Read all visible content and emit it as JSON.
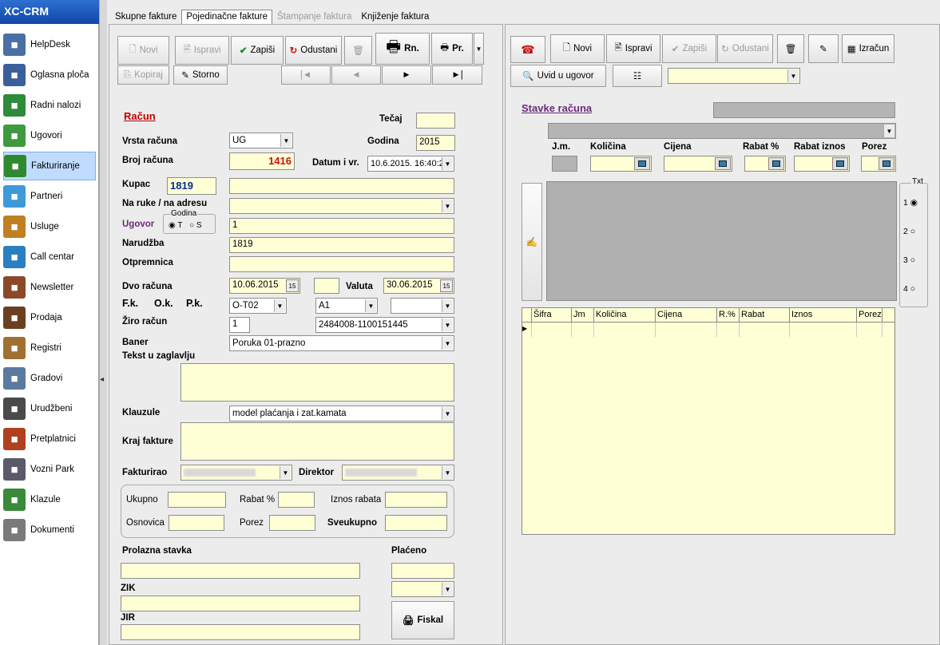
{
  "app": {
    "title": "XC-CRM"
  },
  "sidebar": {
    "items": [
      {
        "label": "HelpDesk",
        "icon": "helpdesk-icon",
        "color": "#4a6fa5"
      },
      {
        "label": "Oglasna ploča",
        "icon": "bulletin-board-icon",
        "color": "#3a5f9a"
      },
      {
        "label": "Radni nalozi",
        "icon": "work-orders-icon",
        "color": "#2e8b3a"
      },
      {
        "label": "Ugovori",
        "icon": "contracts-icon",
        "color": "#3f9a3f"
      },
      {
        "label": "Fakturiranje",
        "icon": "invoicing-icon",
        "color": "#2f8a2f"
      },
      {
        "label": "Partneri",
        "icon": "partners-icon",
        "color": "#3d9ad8"
      },
      {
        "label": "Usluge",
        "icon": "services-icon",
        "color": "#c08020"
      },
      {
        "label": "Call centar",
        "icon": "call-center-icon",
        "color": "#2a7fc0"
      },
      {
        "label": "Newsletter",
        "icon": "newsletter-icon",
        "color": "#8a4a2a"
      },
      {
        "label": "Prodaja",
        "icon": "sales-icon",
        "color": "#6a4020"
      },
      {
        "label": "Registri",
        "icon": "registers-icon",
        "color": "#a07030"
      },
      {
        "label": "Gradovi",
        "icon": "cities-icon",
        "color": "#5a7aa0"
      },
      {
        "label": "Urudžbeni",
        "icon": "registry-icon",
        "color": "#4a4a4a"
      },
      {
        "label": "Pretplatnici",
        "icon": "subscribers-icon",
        "color": "#b04020"
      },
      {
        "label": "Vozni Park",
        "icon": "fleet-icon",
        "color": "#5a5a6a"
      },
      {
        "label": "Klazule",
        "icon": "clauses-icon",
        "color": "#3a8a3a"
      },
      {
        "label": "Dokumenti",
        "icon": "documents-icon",
        "color": "#7a7a7a"
      }
    ]
  },
  "tabs": [
    "Skupne fakture",
    "Pojedinačne fakture",
    "Štampanje faktura",
    "Knjiženje faktura"
  ],
  "left_toolbar": {
    "novi": "Novi",
    "ispravi": "Ispravi",
    "zapisi": "Zapiši",
    "odustani": "Odustani",
    "rn": "Rn.",
    "pr": "Pr.",
    "kopiraj": "Kopiraj",
    "storno": "Storno",
    "nav": [
      "|◄",
      "◄",
      "►",
      "►|"
    ]
  },
  "invoice": {
    "section_title": "Račun",
    "tecaj_label": "Tečaj",
    "tecaj": "",
    "vrsta_label": "Vrsta računa",
    "vrsta": "UG",
    "godina_label": "Godina",
    "godina": "2015",
    "broj_label": "Broj računa",
    "broj": "1416",
    "datum_label": "Datum i vr.",
    "datum": "10.6.2015. 16:40:2",
    "kupac_label": "Kupac",
    "kupac_id": "1819",
    "kupac_name": "",
    "naruke_label": "Na ruke / na adresu",
    "naruke": "",
    "ugovor_label": "Ugovor",
    "godina_group": "Godina",
    "radio_t": "T",
    "radio_s": "S",
    "ugovor": "1",
    "narudzba_label": "Narudžba",
    "narudzba": "1819",
    "otpremnica_label": "Otpremnica",
    "otpremnica": "",
    "dvo_label": "Dvo računa",
    "dvo": "10.06.2015",
    "valuta_label": "Valuta",
    "valuta": "30.06.2015",
    "fk_label": "F.k.",
    "ok_label": "O.k.",
    "pk_label": "P.k.",
    "fk": "O-T02",
    "ok": "A1",
    "pk": "",
    "ziro_label": "Žiro račun",
    "ziro_num": "1",
    "ziro": "2484008-1100151445",
    "baner_label": "Baner",
    "baner": "Poruka  01-prazno",
    "tekst_label": "Tekst u zaglavlju",
    "tekst": "",
    "klauzule_label": "Klauzule",
    "klauzule": "model plaćanja i zat.kamata",
    "kraj_label": "Kraj fakture",
    "kraj": "",
    "fakturirao_label": "Fakturirao",
    "direktor_label": "Direktor",
    "ukupno_label": "Ukupno",
    "rabat_pct_label": "Rabat %",
    "iznos_rabata_label": "Iznos rabata",
    "osnovica_label": "Osnovica",
    "porez_label": "Porez",
    "sveukupno_label": "Sveukupno",
    "prolazna_label": "Prolazna stavka",
    "placeno_label": "Plaćeno",
    "zik_label": "ZIK",
    "jir_label": "JIR",
    "fiskal": "Fiskal"
  },
  "right_toolbar": {
    "novi": "Novi",
    "ispravi": "Ispravi",
    "zapisi": "Zapiši",
    "odustani": "Odustani",
    "izracun": "Izračun",
    "uvid": "Uvid u ugovor"
  },
  "items": {
    "title": "Stavke računa",
    "jm": "J.m.",
    "kolicina": "Količina",
    "cijena": "Cijena",
    "rabat_pct": "Rabat %",
    "rabat_iznos": "Rabat iznos",
    "porez": "Porez",
    "txt": "Txt",
    "radios": [
      "1",
      "2",
      "3",
      "4"
    ],
    "columns": [
      "Šifra",
      "Jm",
      "Količina",
      "Cijena",
      "R.%",
      "Rabat",
      "Iznos",
      "Porez"
    ]
  }
}
